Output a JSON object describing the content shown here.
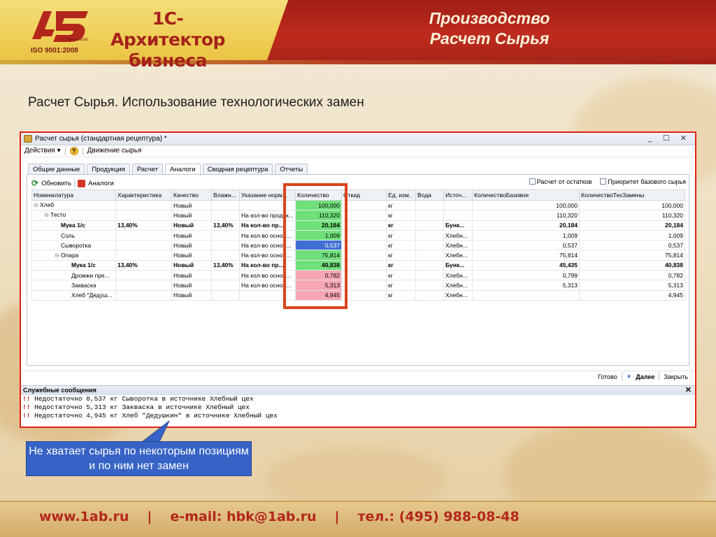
{
  "header": {
    "logo_number": "1-5",
    "logo_caption": "1С:Франчайзи",
    "iso": "ISO 9001:2008",
    "brand_line1": "1С-Архитектор",
    "brand_line2": "бизнеса",
    "title_line1": "Производство",
    "title_line2": "Расчет Сырья"
  },
  "slide_heading": "Расчет Сырья. Использование технологических замен",
  "window": {
    "title": "Расчет сырья (стандартная рецептура) *",
    "controls": "_ ☐ ✕",
    "menu": {
      "actions": "Действия ▾",
      "help": "?",
      "movement": "Движение сырья"
    },
    "tabs": [
      "Общие данные",
      "Продукция",
      "Расчет",
      "Аналоги",
      "Сводная рецептура",
      "Отчеты"
    ],
    "active_tab": "Аналоги",
    "toolbar": {
      "refresh": "Обновить",
      "analogs": "Аналоги"
    },
    "checks": [
      "Расчет от остатков",
      "Приоритет базового сырья"
    ],
    "columns": [
      "Номенклатура",
      "Характеристика",
      "Качество",
      "Влажн...",
      "Указание норм...",
      "Количество",
      "Откид",
      "Ед. изм.",
      "Вода",
      "Источ...",
      "КоличествоБазовое",
      "КоличествоТехЗамены"
    ],
    "rows": [
      {
        "level": 0,
        "mark": "⊖",
        "name": "Хлеб",
        "char": "",
        "quality": "Новый",
        "moist": "",
        "note": "",
        "qty": "100,000",
        "unit": "кг",
        "src": "",
        "base": "100,000",
        "tech": "100,000",
        "hl": "green",
        "bold": false
      },
      {
        "level": 1,
        "mark": "⊖",
        "name": "Тесто",
        "char": "",
        "quality": "Новый",
        "moist": "",
        "note": "На кол-во продук...",
        "qty": "110,320",
        "unit": "кг",
        "src": "",
        "base": "110,320",
        "tech": "110,320",
        "hl": "green",
        "bold": false
      },
      {
        "level": 2,
        "mark": "",
        "name": "Мука 1/с",
        "char": "13,40%",
        "quality": "Новый",
        "moist": "13,40%",
        "note": "На кол-во пр...",
        "qty": "20,184",
        "unit": "кг",
        "src": "Бунк...",
        "base": "20,184",
        "tech": "20,184",
        "hl": "green",
        "bold": true
      },
      {
        "level": 2,
        "mark": "",
        "name": "Соль",
        "char": "",
        "quality": "Новый",
        "moist": "",
        "note": "На кол-во основн...",
        "qty": "1,009",
        "unit": "кг",
        "src": "Хлебн...",
        "base": "1,009",
        "tech": "1,009",
        "hl": "green",
        "bold": false
      },
      {
        "level": 2,
        "mark": "",
        "name": "Сыворотка",
        "char": "",
        "quality": "Новый",
        "moist": "",
        "note": "На кол-во основн...",
        "qty": "0,537",
        "unit": "кг",
        "src": "Хлебн...",
        "base": "0,537",
        "tech": "0,537",
        "hl": "blue",
        "bold": false
      },
      {
        "level": 2,
        "mark": "⊖",
        "name": "Опара",
        "char": "",
        "quality": "Новый",
        "moist": "",
        "note": "На кол-во основн...",
        "qty": "75,814",
        "unit": "кг",
        "src": "Хлебн...",
        "base": "75,814",
        "tech": "75,814",
        "hl": "green",
        "bold": false
      },
      {
        "level": 3,
        "mark": "",
        "name": "Мука 1/с",
        "char": "13,40%",
        "quality": "Новый",
        "moist": "13,40%",
        "note": "На кол-во пр...",
        "qty": "40,838",
        "unit": "кг",
        "src": "Бунк...",
        "base": "45,435",
        "tech": "40,838",
        "hl": "green",
        "bold": true
      },
      {
        "level": 3,
        "mark": "",
        "name": "Дрожжи пре...",
        "char": "",
        "quality": "Новый",
        "moist": "",
        "note": "На кол-во основн...",
        "qty": "0,782",
        "unit": "кг",
        "src": "Хлебн...",
        "base": "0,799",
        "tech": "0,782",
        "hl": "pink",
        "bold": false
      },
      {
        "level": 3,
        "mark": "",
        "name": "Закваска",
        "char": "",
        "quality": "Новый",
        "moist": "",
        "note": "На кол-во основн...",
        "qty": "5,313",
        "unit": "кг",
        "src": "Хлебн...",
        "base": "5,313",
        "tech": "5,313",
        "hl": "pink",
        "bold": false
      },
      {
        "level": 3,
        "mark": "",
        "name": "Хлеб \"Дедуш...",
        "char": "",
        "quality": "Новый",
        "moist": "",
        "note": "",
        "qty": "4,945",
        "unit": "кг",
        "src": "Хлебн...",
        "base": "",
        "tech": "4,945",
        "hl": "pink",
        "bold": false
      }
    ],
    "status": {
      "ready": "Готово",
      "next": "Далее",
      "close": "Закрыть"
    },
    "messages_title": "Служебные сообщения",
    "messages": [
      "Недостаточно 0,537 кг Сыворотка в источнике Хлебный цех",
      "Недостаточно 5,313 кг Закваска в источнике Хлебный цех",
      "Недостаточно 4,945 кг Хлеб \"Дедушкин\" в источнике Хлебный цех"
    ]
  },
  "callout": "Не хватает сырья по некоторым позициям и по ним нет замен",
  "footer": {
    "site": "www.1ab.ru",
    "email": "e-mail: hbk@1ab.ru",
    "phone": "тел.: (495) 988-08-48",
    "sep": "|"
  },
  "colors": {
    "brand_red": "#b3261b",
    "header_yellow": "#efce55",
    "qty_green": "#6fe07a",
    "qty_blue": "#3f6fd4",
    "qty_pink": "#f7a6b4",
    "callout_blue": "#3663c5"
  }
}
